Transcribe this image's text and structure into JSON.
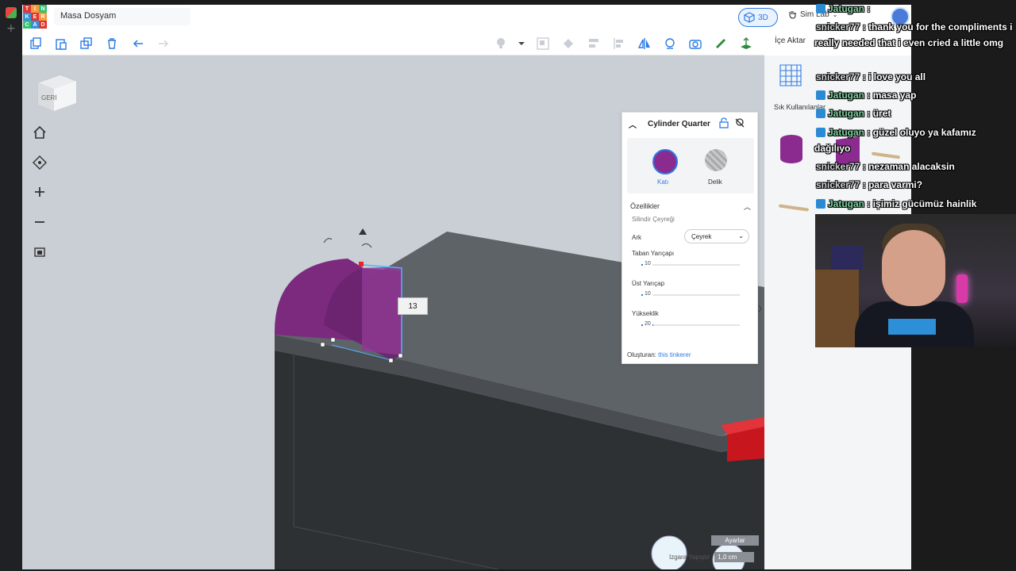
{
  "app": {
    "logo_letters": [
      "T",
      "I",
      "N",
      "K",
      "E",
      "R",
      "C",
      "A",
      "D"
    ],
    "document_title": "Masa Dosyam",
    "view_3d_label": "3D",
    "sim_lab_label": "Sim Lab",
    "import_label": "İçe Aktar"
  },
  "viewport": {
    "viewcube_label": "GERİ",
    "dimension_value": "13",
    "settings_label": "Ayarlar",
    "grid_label": "Izgara Yapıştır",
    "grid_value": "1,0 cm"
  },
  "inspector": {
    "title": "Cylinder Quarter",
    "solid_label": "Katı",
    "hole_label": "Delik",
    "properties_label": "Özellikler",
    "shape_name": "Silindir Çeyreği",
    "arc_label": "Ark",
    "arc_value": "Çeyrek",
    "sliders": [
      {
        "label": "Taban Yarıçapı",
        "value": "10",
        "fraction": 0.05
      },
      {
        "label": "Üst Yarıçap",
        "value": "10",
        "fraction": 0.05
      },
      {
        "label": "Yükseklik",
        "value": "20",
        "fraction": 0.12
      }
    ],
    "creator_label": "Oluşturan:",
    "creator_name": "this tinkerer"
  },
  "shapes_panel": {
    "category_label": "Sık Kullanılanlar"
  },
  "chat": {
    "messages": [
      {
        "user": "Jatugan",
        "text": ":",
        "badge": true
      },
      {
        "user": "snicker77",
        "text": ": thank you for the compliments i",
        "badge": false
      },
      {
        "user": "",
        "text": "really needed that i even cried a little omg",
        "badge": false
      },
      {
        "user": "snicker77",
        "text": ": i love you all",
        "badge": false
      },
      {
        "user": "Jatugan",
        "text": ": masa yap",
        "badge": true
      },
      {
        "user": "Jatugan",
        "text": ": üret",
        "badge": true
      },
      {
        "user": "Jatugan",
        "text": ": güzel oluyo ya kafamız",
        "badge": true
      },
      {
        "user": "",
        "text": "dağılıyo",
        "badge": false
      },
      {
        "user": "snicker77",
        "text": ": nezaman alacaksin",
        "badge": false
      },
      {
        "user": "snicker77",
        "text": ": para varmi?",
        "badge": false
      },
      {
        "user": "Jatugan",
        "text": ": işimiz gücümüz hainlik",
        "badge": true
      }
    ]
  },
  "colors": {
    "accent": "#2c7be5",
    "shape_purple": "#8b2b8f",
    "workplane": "#5e6368",
    "viewport_bg": "#c9cfd5",
    "red_block": "#c8161e"
  }
}
